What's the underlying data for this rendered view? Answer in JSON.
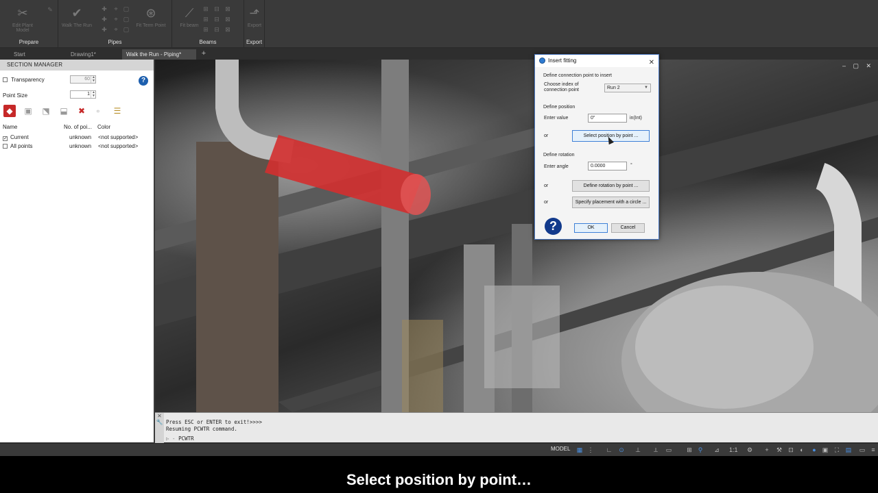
{
  "ribbon": {
    "buttons": [
      "Edit Plant Model",
      "Walk The Run",
      "Fit Pipe",
      "Fit Term Point",
      "Fit beam",
      "Export"
    ],
    "panels": [
      "Prepare",
      "Pipes",
      "Beams",
      "Export"
    ]
  },
  "tabs": [
    {
      "label": "Start"
    },
    {
      "label": "Drawing1*"
    },
    {
      "label": "Walk the Run - Piping*"
    }
  ],
  "section_manager": {
    "title": "SECTION MANAGER",
    "transparency_label": "Transparency",
    "transparency_value": "60",
    "point_size_label": "Point Size",
    "point_size_value": "1",
    "columns": [
      "Name",
      "No. of poi...",
      "Color"
    ],
    "rows": [
      {
        "name": "Current",
        "count": "unknown",
        "color": "<not supported>",
        "checked": true
      },
      {
        "name": "All points",
        "count": "unknown",
        "color": "<not supported>",
        "checked": false
      }
    ]
  },
  "dialog": {
    "title": "Insert fitting",
    "section_connection": "Define connection point to insert",
    "choose_index_label": "Choose index of connection point",
    "run_value": "Run 2",
    "section_position": "Define position",
    "enter_value_label": "Enter value",
    "value_input": "0\"",
    "value_unit": "in(Int)",
    "or": "or",
    "select_position_btn": "Select position by point ...",
    "section_rotation": "Define rotation",
    "enter_angle_label": "Enter angle",
    "angle_input": "0.0000",
    "angle_unit": "°",
    "define_rotation_btn": "Define rotation by point ...",
    "specify_circle_btn": "Specify placement with a circle ...",
    "ok_btn": "OK",
    "cancel_btn": "Cancel"
  },
  "command_line": {
    "line1": "Press ESC or ENTER to exit!>>>>",
    "line2": "Resuming PCWTR command.",
    "prompt": "PCWTR"
  },
  "status": {
    "model": "MODEL"
  },
  "caption": "Select position by point…",
  "colors": {
    "ribbon_bg": "#3a3a3a",
    "dialog_accent": "#3c7fd6",
    "help_blue": "#1d5fae",
    "pipe_red": "#d32f2f"
  }
}
